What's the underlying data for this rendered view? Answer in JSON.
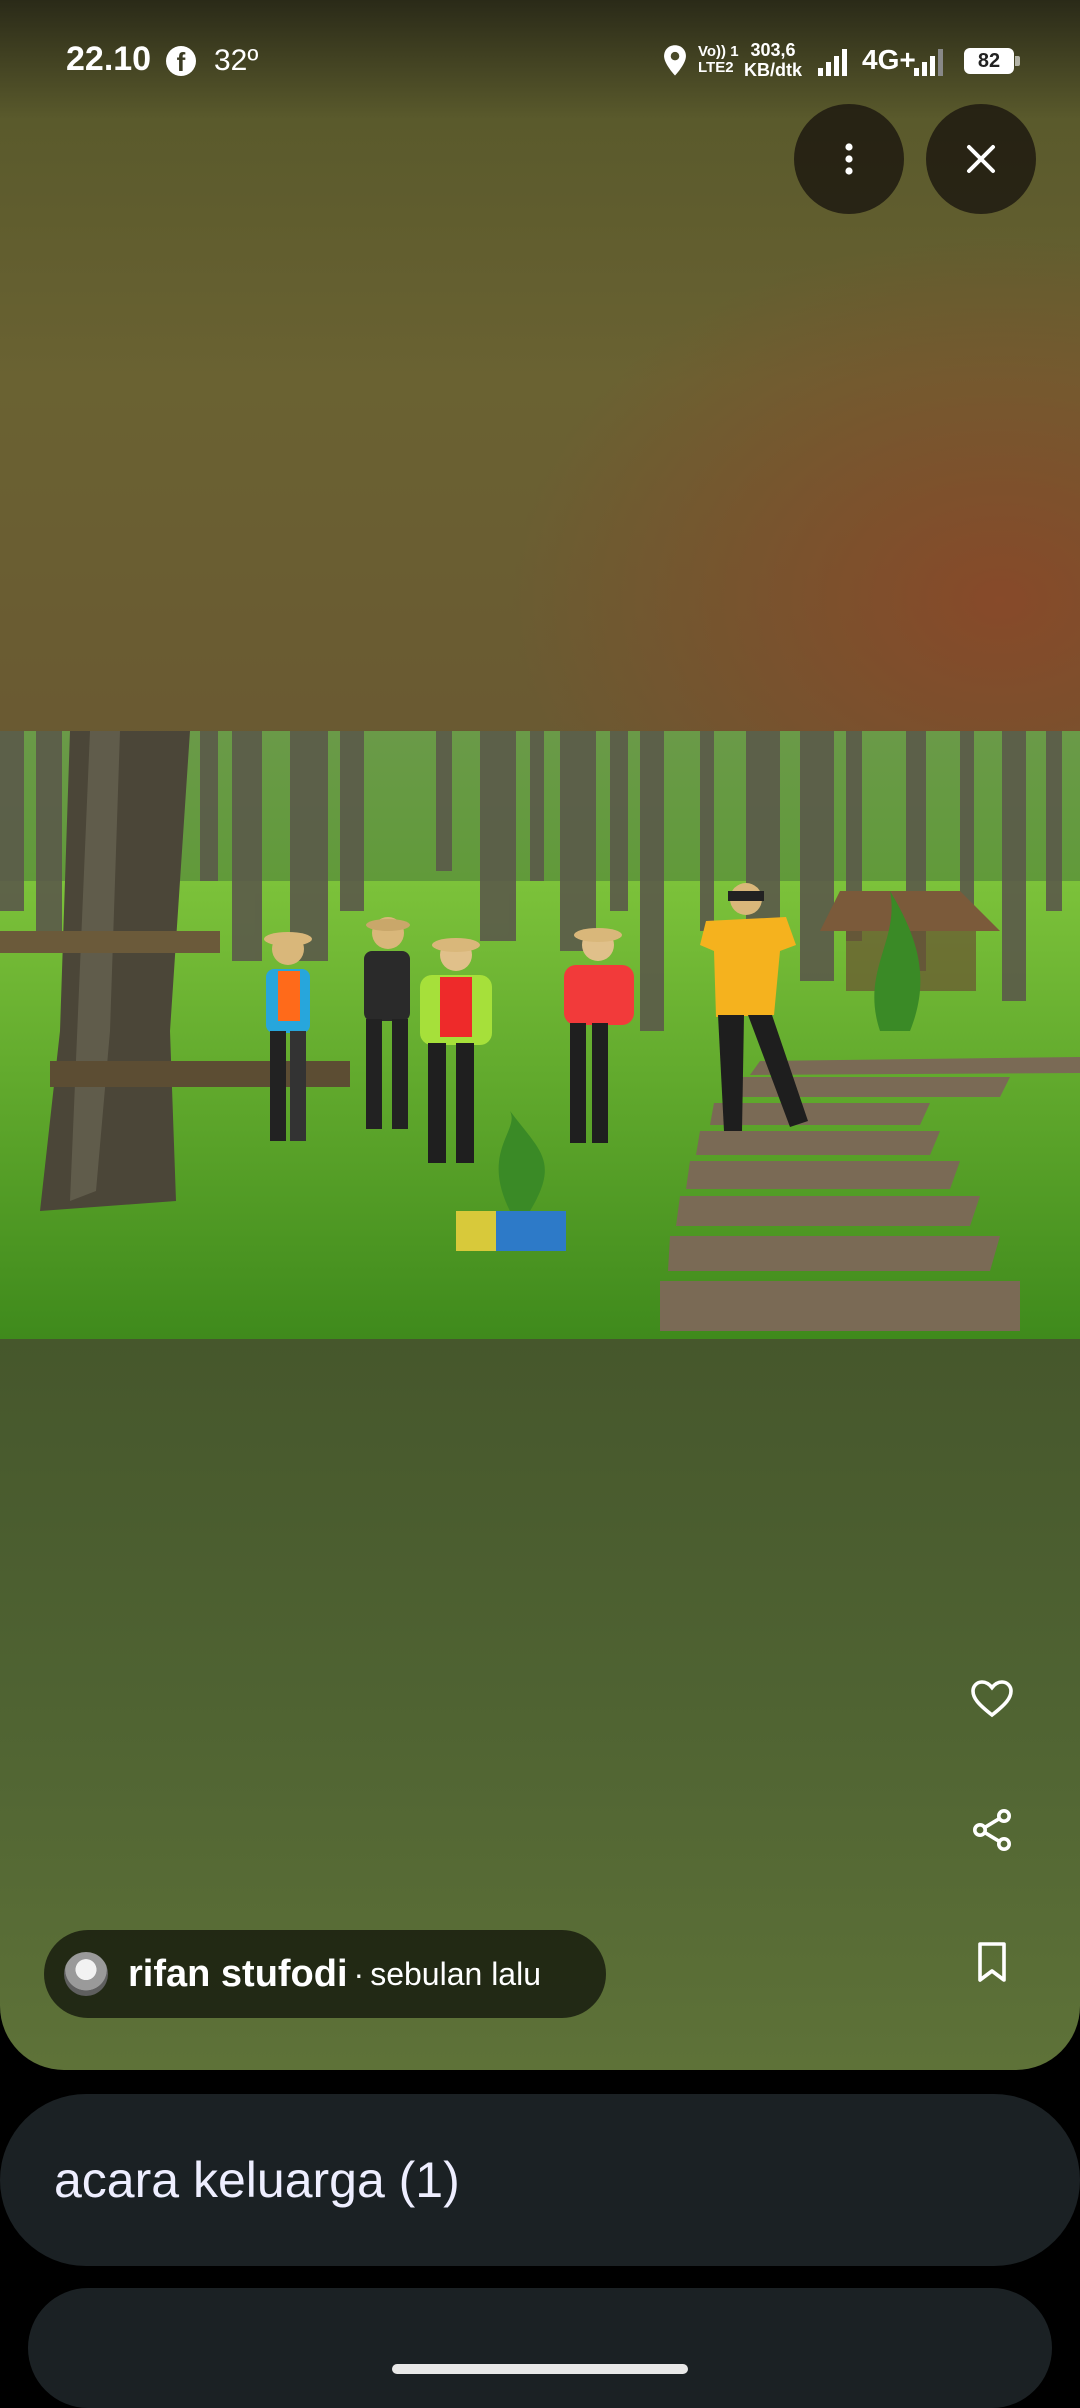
{
  "status_bar": {
    "time": "22.10",
    "app_icon": "facebook-icon",
    "temperature": "32º",
    "volte_line1": "Vo)) 1",
    "volte_line2": "LTE2",
    "speed_value": "303,6",
    "speed_unit": "KB/dtk",
    "network": "4G+",
    "battery": "82"
  },
  "top_actions": {
    "more_icon": "more-vertical-icon",
    "close_icon": "close-icon"
  },
  "side_actions": {
    "like_icon": "heart-icon",
    "share_icon": "share-icon",
    "save_icon": "bookmark-icon"
  },
  "author": {
    "name": "rifan stufodi",
    "separator": "·",
    "time": "sebulan lalu"
  },
  "album": {
    "title": "acara keluarga (1)"
  }
}
